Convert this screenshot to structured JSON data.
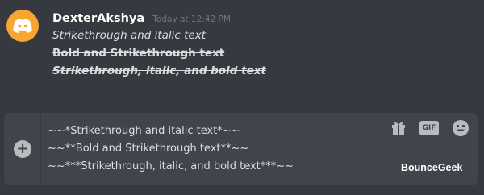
{
  "message": {
    "author": "DexterAkshya",
    "timestamp": "Today at 12:42 PM",
    "lines": [
      "Strikethrough and italic text",
      "Bold and Strikethrough text",
      "Strikethrough, italic, and bold text"
    ]
  },
  "composer": {
    "lines": [
      "~~*Strikethrough and italic text*~~",
      "~~**Bold and Strikethrough text**~~",
      "~~***Strikethrough, italic, and bold text***~~"
    ],
    "gif_label": "GIF"
  },
  "watermark": "BounceGeek",
  "colors": {
    "background": "#36393f",
    "composer": "#40444b",
    "avatar": "#f8a531",
    "text": "#dcddde"
  },
  "icons": [
    "upload-icon",
    "gift-icon",
    "gif-icon",
    "emoji-icon",
    "discord-logo-icon"
  ]
}
